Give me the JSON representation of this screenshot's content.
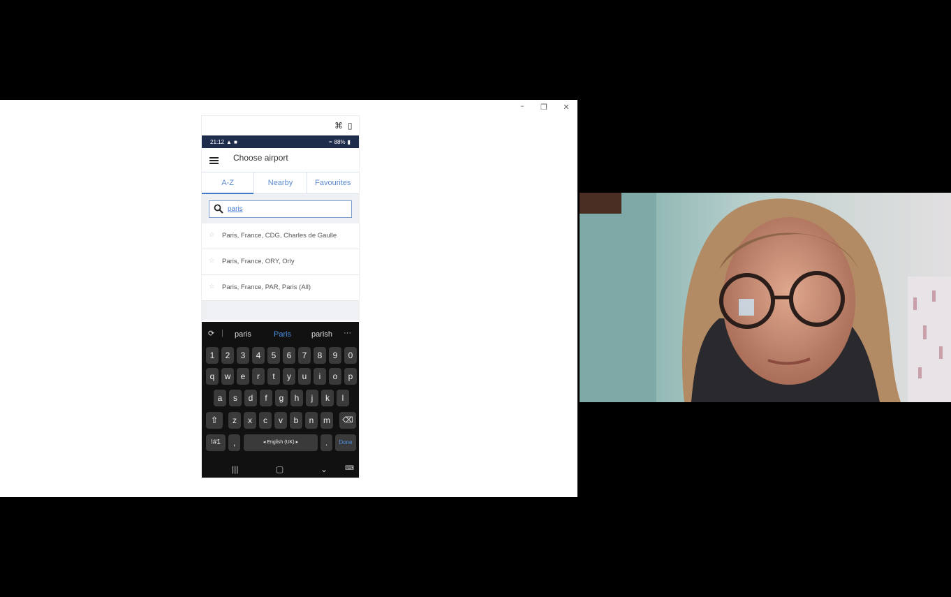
{
  "phone": {
    "status": {
      "time": "21:12",
      "battery": "88%"
    },
    "header": {
      "title": "Choose airport"
    },
    "tabs": [
      {
        "label": "A-Z",
        "active": true
      },
      {
        "label": "Nearby",
        "active": false
      },
      {
        "label": "Favourites",
        "active": false
      }
    ],
    "search": {
      "value": "paris"
    },
    "results": [
      {
        "label": "Paris, France, CDG, Charles de Gaulle"
      },
      {
        "label": "Paris, France, ORY, Orly"
      },
      {
        "label": "Paris, France, PAR, Paris (All)"
      }
    ],
    "keyboard": {
      "suggestions": [
        "paris",
        "Paris",
        "parish"
      ],
      "row_numbers": [
        "1",
        "2",
        "3",
        "4",
        "5",
        "6",
        "7",
        "8",
        "9",
        "0"
      ],
      "row1": [
        "q",
        "w",
        "e",
        "r",
        "t",
        "y",
        "u",
        "i",
        "o",
        "p"
      ],
      "row2": [
        "a",
        "s",
        "d",
        "f",
        "g",
        "h",
        "j",
        "k",
        "l"
      ],
      "row3": [
        "z",
        "x",
        "c",
        "v",
        "b",
        "n",
        "m"
      ],
      "symbols_label": "!#1",
      "comma": ",",
      "space_label": "English (UK)",
      "period": ".",
      "done_label": "Done"
    }
  },
  "colors": {
    "accent": "#3f78c8",
    "status_bar": "#1f2d4c"
  },
  "icons": [
    "minimize-icon",
    "maximize-icon",
    "close-icon",
    "search-icon",
    "star-icon",
    "hamburger-icon",
    "backspace-icon",
    "shift-icon"
  ]
}
